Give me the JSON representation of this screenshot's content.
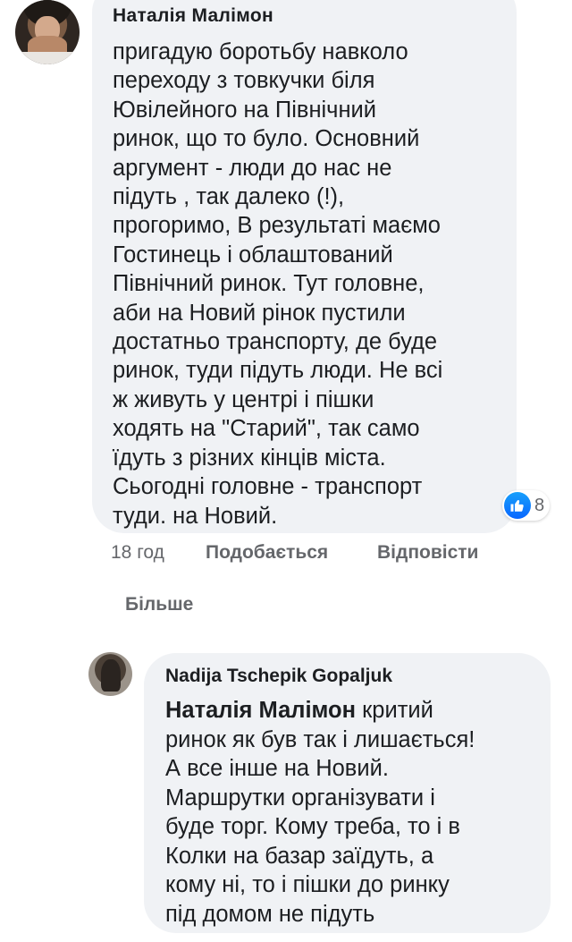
{
  "comment1": {
    "author": "Наталія Малімон",
    "lines": [
      "пригадую боротьбу навколо",
      "переходу з товкучки біля",
      "Ювілейного на Північний",
      "ринок, що то було. Основний",
      "аргумент - люди до нас не",
      "підуть , так далеко (!),",
      "прогоримо, В результаті маємо",
      "Гостинець і облаштований",
      "Північний ринок. Тут головне,",
      "аби на Новий рінок пустили",
      "достатньо транспорту, де буде",
      "ринок, туди підуть люди. Не всі",
      "ж живуть у центрі і пішки",
      "ходять на \"Старий\", так само",
      "їдуть з різних кінців міста.",
      "Сьогодні головне - транспорт",
      "туди. на Новий."
    ],
    "reaction_icon": "like-icon",
    "reaction_count": "8",
    "time": "18 год",
    "like_label": "Подобається",
    "reply_label": "Відповісти"
  },
  "more_label": "Більше",
  "comment2": {
    "author": "Nadija Tschepik Gopaljuk",
    "mention": "Наталія Малімон",
    "first_line_rest": " критий",
    "lines": [
      "ринок як був так і лишається!",
      "А все інше на Новий.",
      "Маршрутки організувати і",
      "буде торг. Кому треба, то і в",
      "Колки на базар заїдуть, а",
      "кому ні, то і пішки до ринку",
      "під домом не підуть"
    ]
  },
  "colors": {
    "bubble": "#f0f2f5",
    "text": "#1c1e21",
    "secondary": "#65676b",
    "like_blue": "#0866ff"
  }
}
